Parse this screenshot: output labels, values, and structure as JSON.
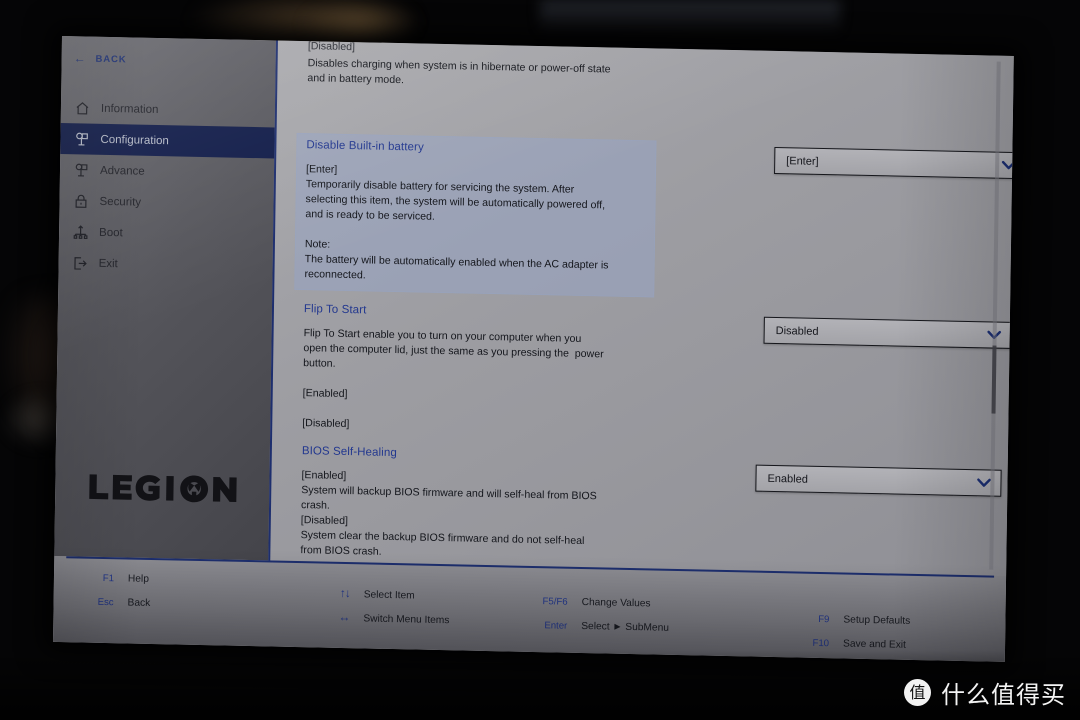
{
  "screen": {
    "device_brand": "LEGION",
    "back_button": {
      "label": "BACK",
      "icon": "arrow-left-icon"
    }
  },
  "sidebar": {
    "items": [
      {
        "label": "Information",
        "icon": "home-icon",
        "active": false
      },
      {
        "label": "Configuration",
        "icon": "shapes-icon",
        "active": true
      },
      {
        "label": "Advance",
        "icon": "shapes-icon",
        "active": false
      },
      {
        "label": "Security",
        "icon": "lock-icon",
        "active": false
      },
      {
        "label": "Boot",
        "icon": "boot-tree-icon",
        "active": false
      },
      {
        "label": "Exit",
        "icon": "exit-arrow-icon",
        "active": false
      }
    ]
  },
  "content": {
    "scrolled_partial_top": {
      "clipped_line": "[Disabled]",
      "body": "Disables charging when system is in hibernate or power-off state\nand in battery mode."
    },
    "settings": [
      {
        "title": "Disable Built-in battery",
        "body": "[Enter]\nTemporarily disable battery for servicing the system. After\nselecting this item, the system will be automatically powered off,\nand is ready to be serviced.\n\nNote:\nThe battery will be automatically enabled when the AC adapter is\nreconnected.",
        "value": "[Enter]",
        "highlighted": true
      },
      {
        "title": "Flip To Start",
        "body": "Flip To Start enable you to turn on your computer when you\nopen the computer lid, just the same as you pressing the  power\nbutton.\n\n[Enabled]\n\n[Disabled]",
        "value": "Disabled",
        "highlighted": false
      },
      {
        "title": "BIOS Self-Healing",
        "body": "[Enabled]\nSystem will backup BIOS firmware and will self-heal from BIOS\ncrash.\n[Disabled]\nSystem clear the backup BIOS firmware and do not self-heal\nfrom BIOS crash.",
        "value": "Enabled",
        "highlighted": false
      }
    ]
  },
  "footer": {
    "columns": [
      {
        "items": [
          {
            "key": "F1",
            "label": "Help",
            "icon": null
          },
          {
            "key": "Esc",
            "label": "Back",
            "icon": null
          }
        ]
      },
      {
        "items": [
          {
            "key": "↑↓",
            "label": "Select Item",
            "icon": "up-down-arrows-icon"
          },
          {
            "key": "↔",
            "label": "Switch Menu Items",
            "icon": "left-right-arrows-icon"
          }
        ]
      },
      {
        "items": [
          {
            "key": "F5/F6",
            "label": "Change Values",
            "icon": null
          },
          {
            "key": "Enter",
            "label": "Select ► SubMenu",
            "icon": null
          }
        ]
      },
      {
        "items": [
          {
            "key": "F9",
            "label": "Setup Defaults",
            "icon": null
          },
          {
            "key": "F10",
            "label": "Save and Exit",
            "icon": null
          }
        ]
      }
    ]
  },
  "watermark": {
    "badge": "值",
    "text": "什么值得买"
  },
  "colors": {
    "accent_blue": "#23388f",
    "active_nav_bg": "#111c49",
    "divider_blue": "#1d2e6e",
    "highlight_bg": "#98a3c0",
    "screen_bg": "#9d9da2"
  }
}
